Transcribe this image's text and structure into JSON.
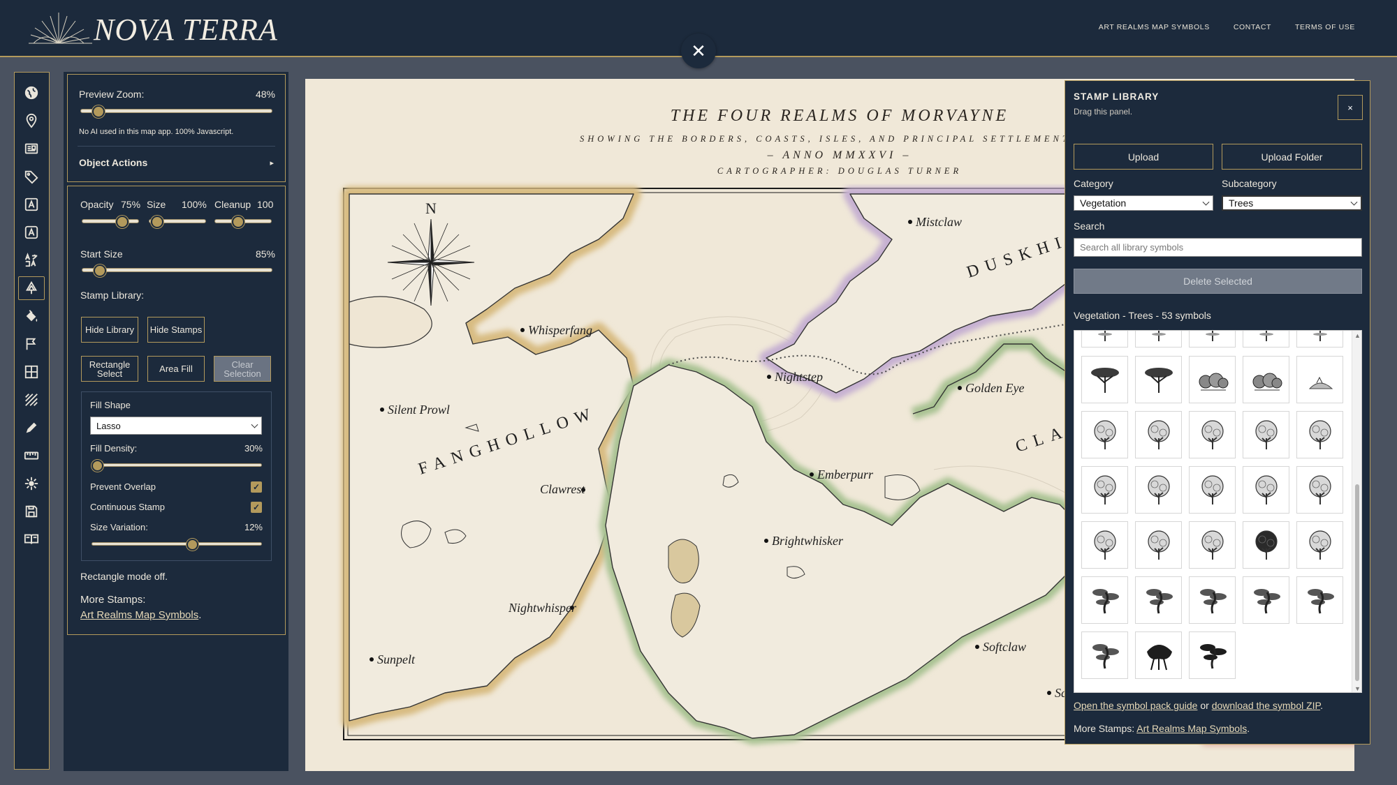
{
  "header": {
    "logo_text": "NOVA TERRA",
    "nav": [
      "ART REALMS MAP SYMBOLS",
      "CONTACT",
      "TERMS OF USE"
    ],
    "close_symbol": "✕"
  },
  "rail": {
    "tools": [
      "globe-icon",
      "map-pin-icon",
      "newspaper-icon",
      "tag-icon",
      "text-icon",
      "text-box-icon",
      "translate-icon",
      "tree-stamp-icon",
      "paint-bucket-icon",
      "flag-icon",
      "grid-icon",
      "hatch-icon",
      "pen-icon",
      "ruler-icon",
      "compass-sun-icon",
      "save-icon",
      "book-icon"
    ],
    "active_tool": "tree-stamp-icon"
  },
  "settings": {
    "preview_zoom_label": "Preview Zoom:",
    "preview_zoom_value": "48%",
    "preview_zoom_level": 0.1,
    "note": "No AI used in this map app. 100% Javascript.",
    "object_actions": "Object Actions",
    "object_actions_arrow": "▸",
    "opacity_label": "Opacity",
    "opacity_value": "75%",
    "size_label": "Size",
    "size_value": "100%",
    "cleanup_label": "Cleanup",
    "cleanup_value": "100",
    "start_size_label": "Start Size",
    "start_size_value": "85%",
    "stamp_library_label": "Stamp Library:",
    "hide_library": "Hide Library",
    "hide_stamps": "Hide Stamps",
    "rectangle_select": "Rectangle Select",
    "area_fill": "Area Fill",
    "clear_selection": "Clear Selection",
    "fill_shape_label": "Fill Shape",
    "fill_shape_value": "Lasso",
    "fill_density_label": "Fill Density:",
    "fill_density_value": "30%",
    "prevent_overlap_label": "Prevent Overlap",
    "prevent_overlap_checked": true,
    "continuous_stamp_label": "Continuous Stamp",
    "continuous_stamp_checked": true,
    "size_variation_label": "Size Variation:",
    "size_variation_value": "12%",
    "rect_mode_status": "Rectangle mode off.",
    "more_stamps_label": "More Stamps:",
    "more_stamps_link": "Art Realms Map Symbols",
    "period": ".",
    "check_mark": "✓"
  },
  "map": {
    "title": "THE FOUR REALMS OF MORVAYNE",
    "subtitle": "SHOWING THE BORDERS, COASTS, ISLES, AND PRINCIPAL SETTLEMENTS",
    "anno": "– ANNO MMXXVI –",
    "cartographer": "CARTOGRAPHER: DOUGLAS TURNER",
    "compass_n": "N",
    "region_labels": [
      "FANGHOLLOW",
      "DUSKHI",
      "CLA"
    ],
    "towns": [
      "Whisperfang",
      "Mistclaw",
      "Silent Prowl",
      "Nightstep",
      "Golden Eye",
      "Clawrest",
      "Emberpurr",
      "Brightwhisker",
      "Nightwhisper",
      "Sunpelt",
      "Softclaw",
      "Sc"
    ],
    "colors": {
      "parchment": "#f0e8d8",
      "fanghollow_border": "#d8bc82",
      "duskhi_border": "#c6b0d2",
      "green_border": "#a9c293",
      "red_border": "#e0b0a6"
    }
  },
  "library": {
    "title": "STAMP LIBRARY",
    "drag_hint": "Drag this panel.",
    "close_symbol": "×",
    "upload": "Upload",
    "upload_folder": "Upload Folder",
    "category_label": "Category",
    "category_value": "Vegetation",
    "subcategory_label": "Subcategory",
    "subcategory_value": "Trees",
    "search_label": "Search",
    "search_placeholder": "Search all library symbols",
    "delete_selected": "Delete Selected",
    "summary": "Vegetation - Trees - 53 symbols",
    "guide_link": "Open the symbol pack guide",
    "or_text": "or",
    "zip_link": "download the symbol ZIP",
    "period": ".",
    "more_stamps_label": "More Stamps:",
    "more_stamps_link": "Art Realms Map Symbols",
    "scroll_position": 0.6,
    "scroll_up": "▲",
    "scroll_down": "▼",
    "symbol_types": [
      "acacia",
      "umbrella-pine",
      "shrubs",
      "bush",
      "grass-tuft",
      "oak",
      "oak",
      "oak",
      "oak",
      "poplar",
      "oak",
      "oak",
      "birch",
      "birch",
      "birch",
      "birch",
      "birch",
      "birch",
      "dark-oak",
      "round-oak",
      "bonsai",
      "bonsai",
      "bonsai",
      "bonsai",
      "pine-bonsai",
      "bonsai",
      "mangrove",
      "dark-bonsai"
    ]
  }
}
